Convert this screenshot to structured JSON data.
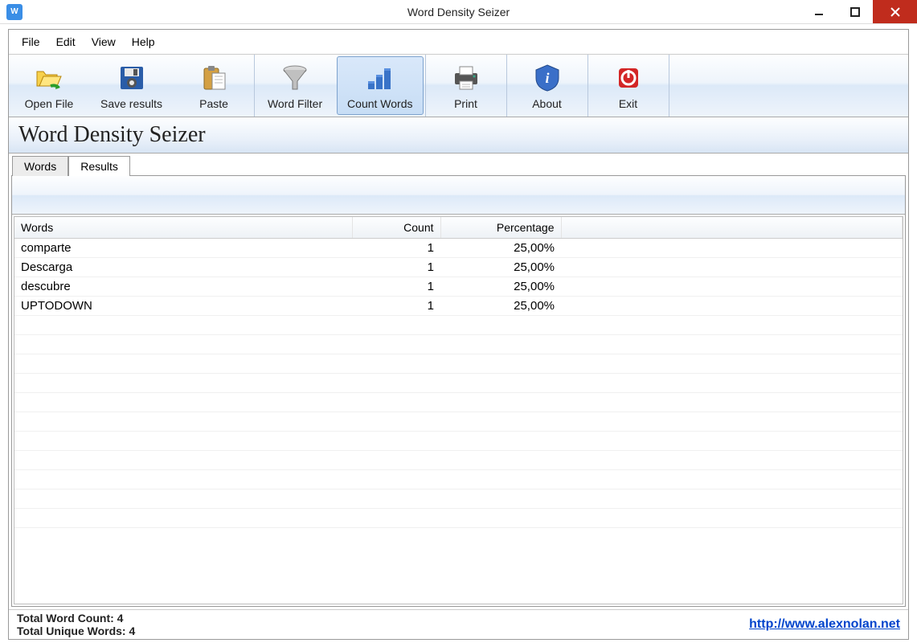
{
  "titlebar": {
    "title": "Word Density Seizer"
  },
  "menubar": {
    "items": [
      "File",
      "Edit",
      "View",
      "Help"
    ]
  },
  "toolbar": {
    "groups": [
      {
        "buttons": [
          {
            "name": "open-file-button",
            "icon": "folder-open-icon",
            "label": "Open File"
          },
          {
            "name": "save-results-button",
            "icon": "save-icon",
            "label": "Save results"
          },
          {
            "name": "paste-button",
            "icon": "paste-icon",
            "label": "Paste"
          }
        ]
      },
      {
        "buttons": [
          {
            "name": "word-filter-button",
            "icon": "funnel-icon",
            "label": "Word Filter"
          },
          {
            "name": "count-words-button",
            "icon": "bars-icon",
            "label": "Count Words",
            "active": true
          }
        ]
      },
      {
        "buttons": [
          {
            "name": "print-button",
            "icon": "printer-icon",
            "label": "Print"
          }
        ]
      },
      {
        "buttons": [
          {
            "name": "about-button",
            "icon": "info-shield-icon",
            "label": "About"
          }
        ]
      },
      {
        "buttons": [
          {
            "name": "exit-button",
            "icon": "exit-icon",
            "label": "Exit"
          }
        ]
      }
    ]
  },
  "heading": "Word Density Seizer",
  "tabs": {
    "items": [
      {
        "label": "Words",
        "active": false
      },
      {
        "label": "Results",
        "active": true
      }
    ]
  },
  "grid": {
    "columns": {
      "words": "Words",
      "count": "Count",
      "pct": "Percentage"
    },
    "rows": [
      {
        "word": "comparte",
        "count": "1",
        "pct": "25,00%"
      },
      {
        "word": "Descarga",
        "count": "1",
        "pct": "25,00%"
      },
      {
        "word": "descubre",
        "count": "1",
        "pct": "25,00%"
      },
      {
        "word": "UPTODOWN",
        "count": "1",
        "pct": "25,00%"
      }
    ]
  },
  "status": {
    "total_count": "Total Word Count: 4",
    "unique_count": "Total Unique Words: 4",
    "link": "http://www.alexnolan.net"
  }
}
